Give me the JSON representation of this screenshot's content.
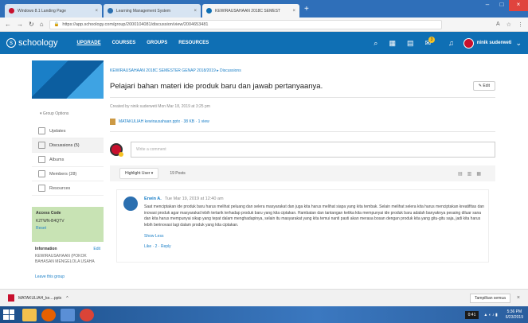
{
  "browser": {
    "tabs": [
      {
        "label": "Windows 8.1 Landing Page",
        "color": "#c8102e"
      },
      {
        "label": "Learning Management System",
        "color": "#2b6fb0"
      },
      {
        "label": "KEWIRAUSAHAAN 2018C SEMEST",
        "color": "#0f6fb4"
      }
    ],
    "url": "https://app.schoology.com/group/2000104081/discussion/view/2004653481"
  },
  "topnav": {
    "logo": "schoology",
    "links": [
      "UPGRADE",
      "COURSES",
      "GROUPS",
      "RESOURCES"
    ],
    "badge": "3",
    "user": "ninik suderweti"
  },
  "sidebar": {
    "group_options": "Group Options",
    "items": [
      "Updates",
      "Discussions (5)",
      "Albums",
      "Members (28)",
      "Resources"
    ],
    "access": {
      "title": "Access Code",
      "code": "K2TWN-B4QTV",
      "reset": "Reset"
    },
    "info": {
      "title": "Information",
      "edit": "Edit",
      "text": "KEWIRAUSAHAAN (POKOK BAHASAN MENGELOLA USAHA"
    },
    "leave": "Leave this group"
  },
  "main": {
    "breadcrumb": "KEWIRAUSAHAAN 2018C SEMESTER GENAP 2018/2019 ▸ Discussions",
    "title": "Pelajari bahan materi ide produk baru dan jawab pertanyaanya.",
    "edit": "Edit",
    "meta": "Created by ninik suderweti Mon Mar 18, 2019 at 3:25 pm",
    "attachment": "MATAKULIAH kewirausahaan.pptx · 38 KB · 1 view",
    "comment_placeholder": "Write a comment",
    "filter": "Highlight User ▾",
    "posts": "19 Posts",
    "post": {
      "author": "Erwin A.",
      "time": "Tue Mar 19, 2019 at 12:40 am",
      "text": "Saat menciptakan ide produk baru harus melihat peluang dan selera masyarakat dan juga kita harus melihat siapa yang kita tembak. Selain melihat selera kita harus menciptakan kreatifitas dan inovasi produk agar masyarakat lebih tertarik terhadap produk baru yang kita ciptakan. Hambatan dan tantangan ketika kita mempunyai ide produk baru adalah banyaknya pesaing diluar sana dan kita harus mempunyai sikap yang tepat dalam menghadapinya, selain itu masyarakat yang kita temui nanti pasti akan merasa bosan dengan produk kita yang gitu-gitu saja, jadi kita harus lebih berinovasi lagi dalam produk yang kita ciptakan.",
      "show_less": "Show Less",
      "like": "Like · 2 · Reply"
    }
  },
  "downloads": {
    "file": "MATAKULIAH_ke....pptx",
    "show_all": "Tampilkan semua"
  },
  "taskbar": {
    "time": "5:36 PM",
    "date": "6/23/2019",
    "chip": "0:41"
  }
}
